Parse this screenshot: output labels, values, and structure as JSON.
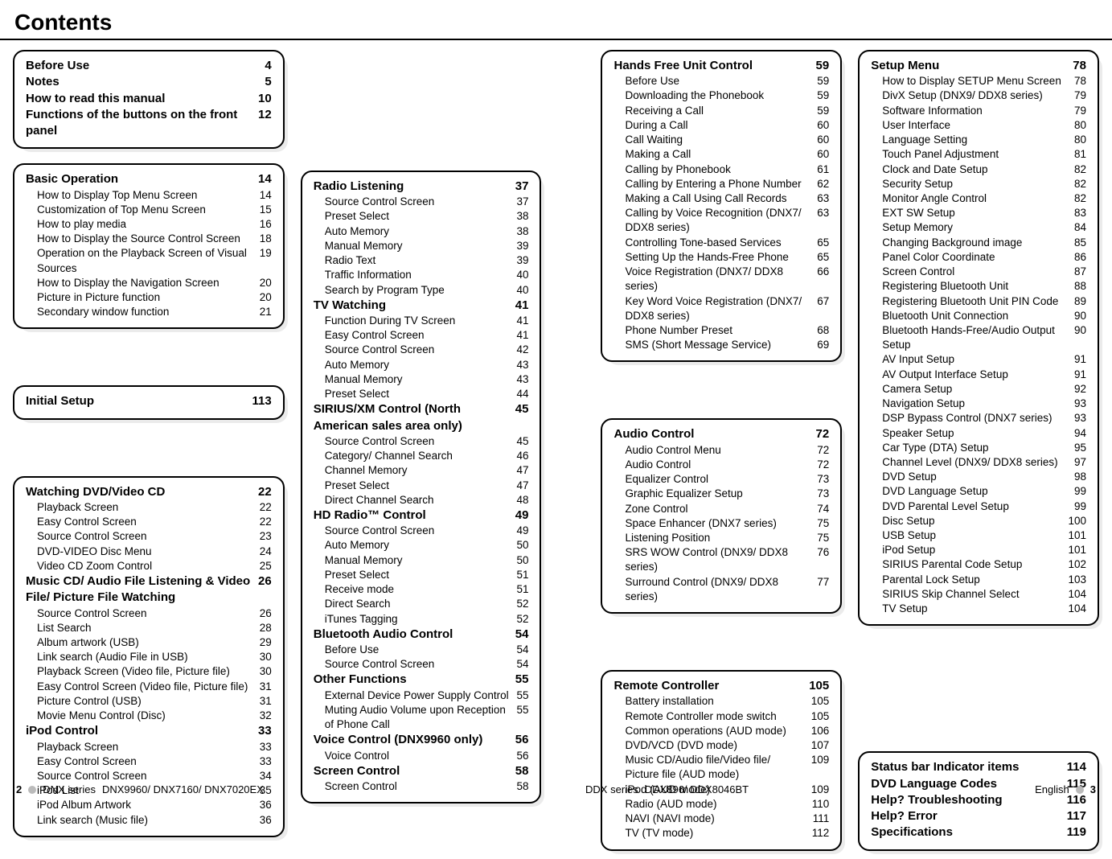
{
  "heading": "Contents",
  "footer": {
    "leftPage": "2",
    "leftSeries": "DNX series",
    "leftModels": "DNX9960/ DNX7160/ DNX7020EX",
    "rightSeries": "DDX series",
    "rightModels": "DDX896/ DDX8046BT",
    "rightLang": "English",
    "rightPage": "3"
  },
  "col1": {
    "boxA": [
      {
        "t": "Before Use",
        "p": "4",
        "b": true
      },
      {
        "t": "Notes",
        "p": "5",
        "b": true
      },
      {
        "t": "How to read this manual",
        "p": "10",
        "b": true
      },
      {
        "t": "Functions of the buttons on the front panel",
        "p": "12",
        "b": true
      }
    ],
    "boxB_head": {
      "t": "Basic Operation",
      "p": "14"
    },
    "boxB": [
      {
        "t": "How to Display Top Menu Screen",
        "p": "14"
      },
      {
        "t": "Customization of Top Menu Screen",
        "p": "15"
      },
      {
        "t": "How to play media",
        "p": "16"
      },
      {
        "t": "How to Display the Source Control Screen",
        "p": "18"
      },
      {
        "t": "Operation on the Playback Screen of Visual Sources",
        "p": "19",
        "wrap": true
      },
      {
        "t": "How to Display the Navigation Screen",
        "p": "20"
      },
      {
        "t": "Picture in Picture function",
        "p": "20"
      },
      {
        "t": "Secondary window function",
        "p": "21"
      }
    ],
    "boxC_head": {
      "t": "Initial Setup",
      "p": "113"
    },
    "boxD": [
      {
        "t": "Watching DVD/Video CD",
        "p": "22",
        "b": true
      },
      {
        "t": "Playback Screen",
        "p": "22"
      },
      {
        "t": "Easy Control Screen",
        "p": "22"
      },
      {
        "t": "Source Control Screen",
        "p": "23"
      },
      {
        "t": "DVD-VIDEO Disc Menu",
        "p": "24"
      },
      {
        "t": "Video CD Zoom Control",
        "p": "25"
      },
      {
        "t": "Music CD/ Audio File Listening & Video File/ Picture File Watching",
        "p": "26",
        "b": true,
        "noindent": true
      },
      {
        "t": "Source Control Screen",
        "p": "26"
      },
      {
        "t": "List Search",
        "p": "28"
      },
      {
        "t": "Album artwork (USB)",
        "p": "29"
      },
      {
        "t": "Link search (Audio File in USB)",
        "p": "30"
      },
      {
        "t": "Playback Screen (Video file, Picture file)",
        "p": "30"
      },
      {
        "t": "Easy Control Screen (Video file, Picture file)",
        "p": "31"
      },
      {
        "t": "Picture Control (USB)",
        "p": "31"
      },
      {
        "t": "Movie Menu Control (Disc)",
        "p": "32"
      },
      {
        "t": "iPod Control",
        "p": "33",
        "b": true,
        "noindent": true
      },
      {
        "t": "Playback Screen",
        "p": "33"
      },
      {
        "t": "Easy Control Screen",
        "p": "33"
      },
      {
        "t": "Source Control Screen",
        "p": "34"
      },
      {
        "t": "iPod List",
        "p": "35"
      },
      {
        "t": "iPod Album Artwork",
        "p": "36"
      },
      {
        "t": "Link search (Music file)",
        "p": "36"
      }
    ]
  },
  "col2": {
    "box": [
      {
        "t": "Radio Listening",
        "p": "37",
        "b": true,
        "noindent": true
      },
      {
        "t": "Source Control Screen",
        "p": "37"
      },
      {
        "t": "Preset Select",
        "p": "38"
      },
      {
        "t": "Auto Memory",
        "p": "38"
      },
      {
        "t": "Manual Memory",
        "p": "39"
      },
      {
        "t": "Radio Text",
        "p": "39"
      },
      {
        "t": "Traffic Information",
        "p": "40"
      },
      {
        "t": "Search by Program Type",
        "p": "40"
      },
      {
        "t": "TV Watching",
        "p": "41",
        "b": true,
        "noindent": true
      },
      {
        "t": "Function During TV Screen",
        "p": "41"
      },
      {
        "t": "Easy Control Screen",
        "p": "41"
      },
      {
        "t": "Source Control Screen",
        "p": "42"
      },
      {
        "t": "Auto Memory",
        "p": "43"
      },
      {
        "t": "Manual Memory",
        "p": "43"
      },
      {
        "t": "Preset Select",
        "p": "44"
      },
      {
        "t": "SIRIUS/XM Control (North American sales area only)",
        "p": "45",
        "b": true,
        "noindent": true
      },
      {
        "t": "Source Control Screen",
        "p": "45"
      },
      {
        "t": "Category/ Channel Search",
        "p": "46"
      },
      {
        "t": "Channel Memory",
        "p": "47"
      },
      {
        "t": "Preset Select",
        "p": "47"
      },
      {
        "t": "Direct Channel Search",
        "p": "48"
      },
      {
        "t": "HD Radio™ Control",
        "p": "49",
        "b": true,
        "noindent": true
      },
      {
        "t": "Source Control Screen",
        "p": "49"
      },
      {
        "t": "Auto Memory",
        "p": "50"
      },
      {
        "t": "Manual Memory",
        "p": "50"
      },
      {
        "t": "Preset Select",
        "p": "51"
      },
      {
        "t": "Receive mode",
        "p": "51"
      },
      {
        "t": "Direct Search",
        "p": "52"
      },
      {
        "t": "iTunes Tagging",
        "p": "52"
      },
      {
        "t": "Bluetooth Audio Control",
        "p": "54",
        "b": true,
        "noindent": true
      },
      {
        "t": "Before Use",
        "p": "54"
      },
      {
        "t": "Source Control Screen",
        "p": "54"
      },
      {
        "t": "Other Functions",
        "p": "55",
        "b": true,
        "noindent": true
      },
      {
        "t": "External Device Power Supply Control",
        "p": "55"
      },
      {
        "t": "Muting Audio Volume upon Reception of Phone Call",
        "p": "55",
        "wrap": true
      },
      {
        "t": "Voice Control (DNX9960 only)",
        "p": "56",
        "b": true,
        "noindent": true
      },
      {
        "t": "Voice Control",
        "p": "56"
      },
      {
        "t": "Screen Control",
        "p": "58",
        "b": true,
        "noindent": true
      },
      {
        "t": "Screen Control",
        "p": "58"
      }
    ]
  },
  "col3": {
    "boxA_head": {
      "t": "Hands Free Unit Control",
      "p": "59"
    },
    "boxA": [
      {
        "t": "Before Use",
        "p": "59"
      },
      {
        "t": "Downloading the Phonebook",
        "p": "59"
      },
      {
        "t": "Receiving a Call",
        "p": "59"
      },
      {
        "t": "During a Call",
        "p": "60"
      },
      {
        "t": "Call Waiting",
        "p": "60"
      },
      {
        "t": "Making a Call",
        "p": "60"
      },
      {
        "t": "Calling by Phonebook",
        "p": "61"
      },
      {
        "t": "Calling by Entering a Phone Number",
        "p": "62"
      },
      {
        "t": "Making a Call Using Call Records",
        "p": "63"
      },
      {
        "t": "Calling by Voice Recognition (DNX7/ DDX8 series)",
        "p": "63",
        "wrap": true
      },
      {
        "t": "Controlling Tone-based Services",
        "p": "65"
      },
      {
        "t": "Setting Up the Hands-Free Phone",
        "p": "65"
      },
      {
        "t": "Voice Registration (DNX7/ DDX8 series)",
        "p": "66",
        "wrap": true
      },
      {
        "t": "Key Word Voice Registration (DNX7/ DDX8 series)",
        "p": "67",
        "wrap": true
      },
      {
        "t": "Phone Number Preset",
        "p": "68"
      },
      {
        "t": "SMS (Short Message Service)",
        "p": "69"
      }
    ],
    "boxB_head": {
      "t": "Audio Control",
      "p": "72"
    },
    "boxB": [
      {
        "t": "Audio Control Menu",
        "p": "72"
      },
      {
        "t": "Audio Control",
        "p": "72"
      },
      {
        "t": "Equalizer Control",
        "p": "73"
      },
      {
        "t": "Graphic Equalizer Setup",
        "p": "73"
      },
      {
        "t": "Zone Control",
        "p": "74"
      },
      {
        "t": "Space Enhancer (DNX7 series)",
        "p": "75"
      },
      {
        "t": "Listening Position",
        "p": "75"
      },
      {
        "t": "SRS WOW Control (DNX9/ DDX8 series)",
        "p": "76"
      },
      {
        "t": "Surround Control (DNX9/ DDX8 series)",
        "p": "77"
      }
    ],
    "boxC_head": {
      "t": "Remote Controller",
      "p": "105"
    },
    "boxC": [
      {
        "t": "Battery installation",
        "p": "105"
      },
      {
        "t": "Remote Controller mode switch",
        "p": "105"
      },
      {
        "t": "Common operations (AUD mode)",
        "p": "106"
      },
      {
        "t": "DVD/VCD (DVD mode)",
        "p": "107"
      },
      {
        "t": "Music CD/Audio file/Video file/ Picture file (AUD mode)",
        "p": "109",
        "wrap": true
      },
      {
        "t": "iPod (AUD mode)",
        "p": "109"
      },
      {
        "t": "Radio (AUD mode)",
        "p": "110"
      },
      {
        "t": "NAVI (NAVI mode)",
        "p": "111"
      },
      {
        "t": "TV (TV mode)",
        "p": "112"
      }
    ]
  },
  "col4": {
    "boxA_head": {
      "t": "Setup Menu",
      "p": "78"
    },
    "boxA": [
      {
        "t": "How to Display SETUP Menu Screen",
        "p": "78"
      },
      {
        "t": "DivX Setup (DNX9/ DDX8 series)",
        "p": "79"
      },
      {
        "t": "Software Information",
        "p": "79"
      },
      {
        "t": "User Interface",
        "p": "80"
      },
      {
        "t": "Language Setting",
        "p": "80"
      },
      {
        "t": "Touch Panel Adjustment",
        "p": "81"
      },
      {
        "t": "Clock and Date Setup",
        "p": "82"
      },
      {
        "t": "Security Setup",
        "p": "82"
      },
      {
        "t": "Monitor Angle Control",
        "p": "82"
      },
      {
        "t": "EXT SW Setup",
        "p": "83"
      },
      {
        "t": "Setup Memory",
        "p": "84"
      },
      {
        "t": "Changing Background image",
        "p": "85"
      },
      {
        "t": "Panel Color Coordinate",
        "p": "86"
      },
      {
        "t": "Screen Control",
        "p": "87"
      },
      {
        "t": "Registering Bluetooth Unit",
        "p": "88"
      },
      {
        "t": "Registering Bluetooth Unit PIN Code",
        "p": "89"
      },
      {
        "t": "Bluetooth Unit Connection",
        "p": "90"
      },
      {
        "t": "Bluetooth Hands-Free/Audio Output Setup",
        "p": "90",
        "wrap": true
      },
      {
        "t": "AV Input Setup",
        "p": "91"
      },
      {
        "t": "AV Output Interface Setup",
        "p": "91"
      },
      {
        "t": "Camera Setup",
        "p": "92"
      },
      {
        "t": "Navigation Setup",
        "p": "93"
      },
      {
        "t": "DSP Bypass Control (DNX7 series)",
        "p": "93"
      },
      {
        "t": "Speaker Setup",
        "p": "94"
      },
      {
        "t": "Car Type (DTA) Setup",
        "p": "95"
      },
      {
        "t": "Channel Level (DNX9/ DDX8 series)",
        "p": "97"
      },
      {
        "t": "DVD Setup",
        "p": "98"
      },
      {
        "t": "DVD Language Setup",
        "p": "99"
      },
      {
        "t": "DVD Parental Level Setup",
        "p": "99"
      },
      {
        "t": "Disc Setup",
        "p": "100"
      },
      {
        "t": "USB Setup",
        "p": "101"
      },
      {
        "t": "iPod Setup",
        "p": "101"
      },
      {
        "t": "SIRIUS Parental Code Setup",
        "p": "102"
      },
      {
        "t": "Parental Lock Setup",
        "p": "103"
      },
      {
        "t": "SIRIUS Skip Channel Select",
        "p": "104"
      },
      {
        "t": "TV Setup",
        "p": "104"
      }
    ],
    "boxB": [
      {
        "t": "Status bar Indicator items",
        "p": "114",
        "b": true
      },
      {
        "t": "DVD Language Codes",
        "p": "115",
        "b": true
      },
      {
        "t": "Help? Troubleshooting",
        "p": "116",
        "b": true
      },
      {
        "t": "Help? Error",
        "p": "117",
        "b": true
      },
      {
        "t": "Specifications",
        "p": "119",
        "b": true
      }
    ]
  }
}
